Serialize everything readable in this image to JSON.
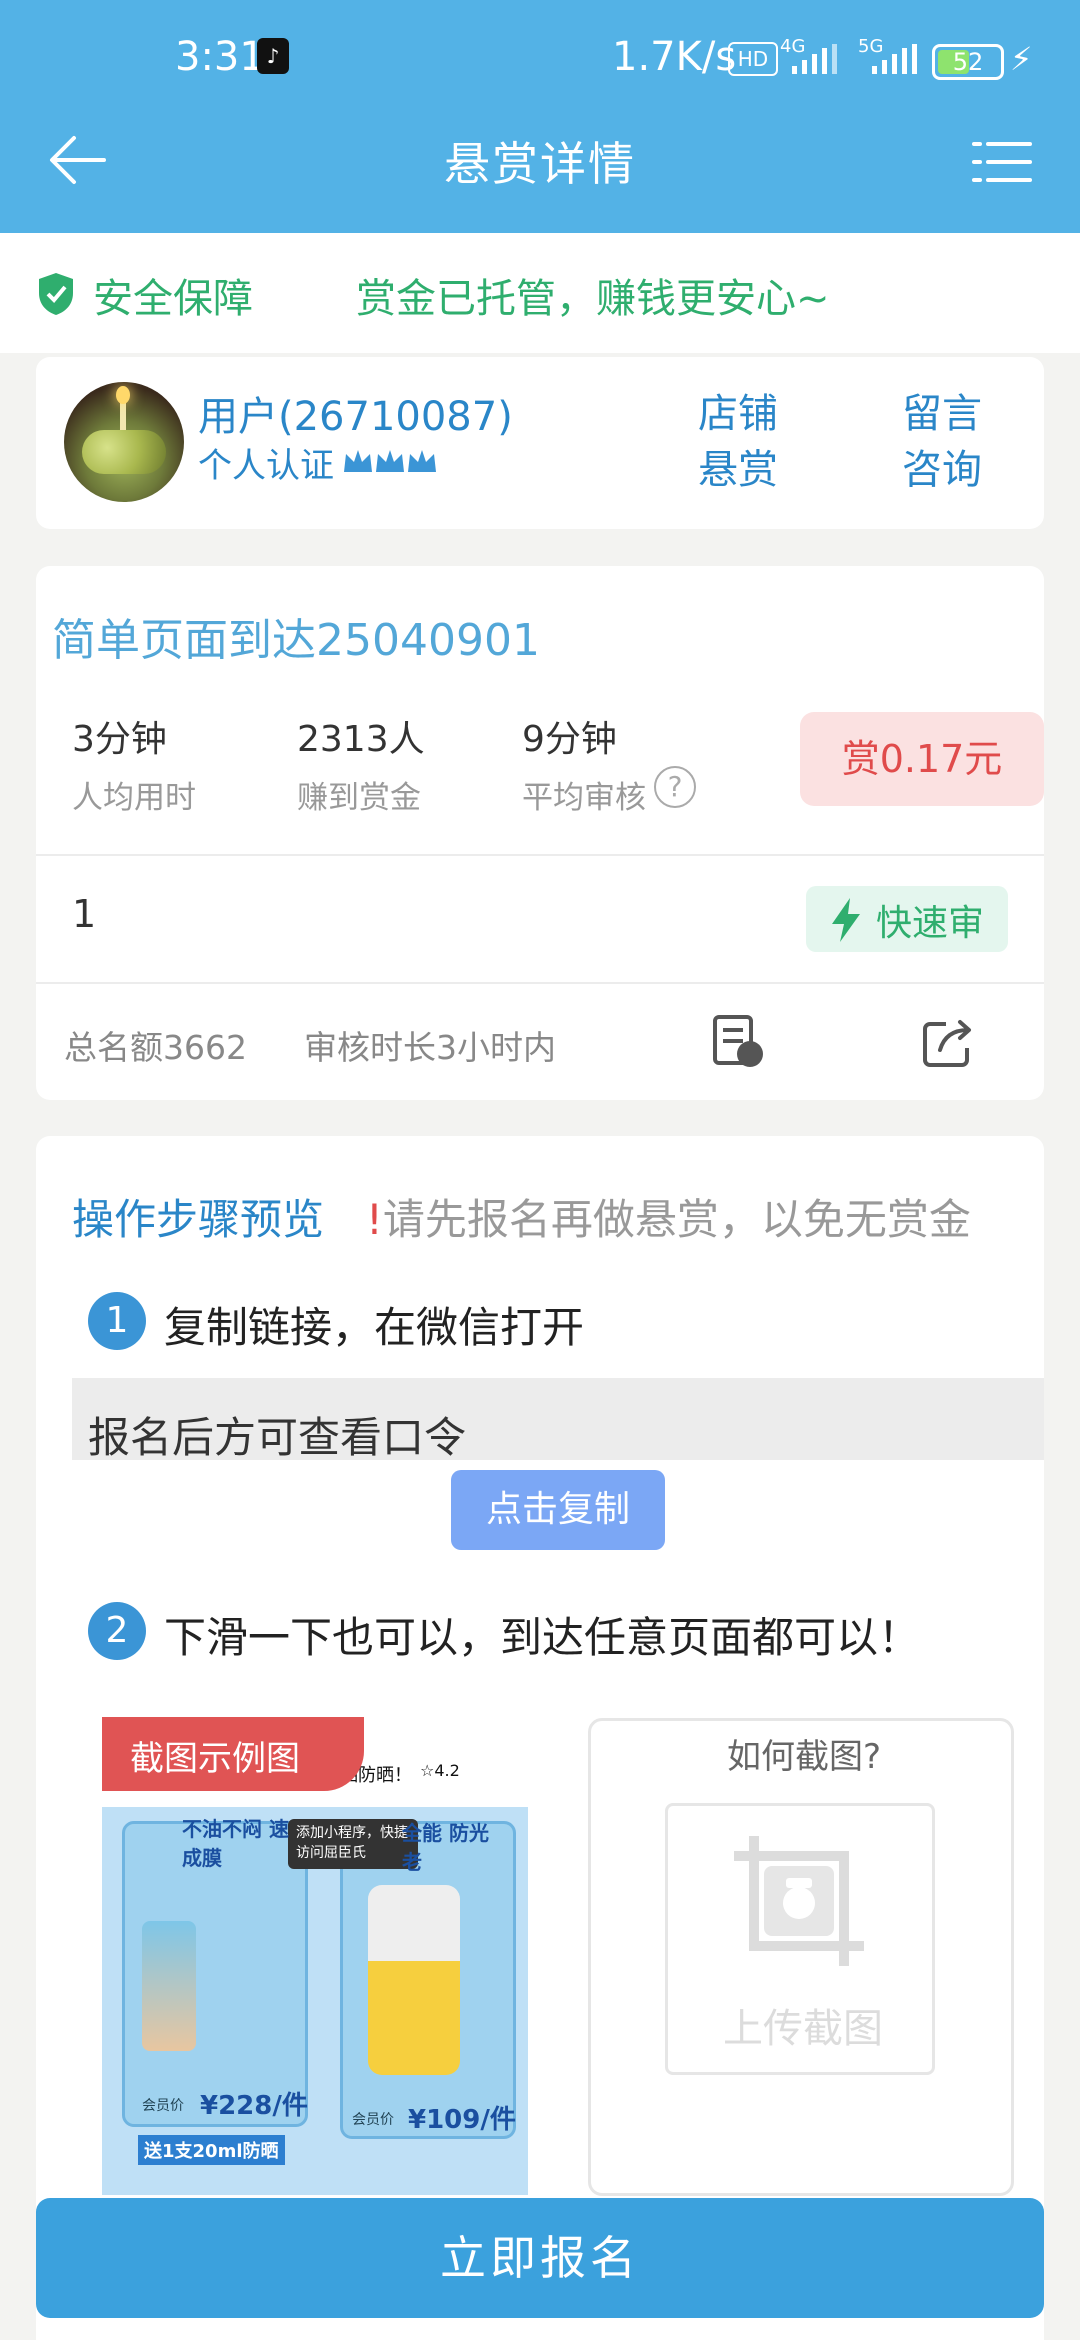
{
  "status_bar": {
    "time": "3:31",
    "net_speed": "1.7K/s",
    "hd_badge": "HD",
    "net1": "4G",
    "net2": "5G",
    "battery": "52",
    "battery_level": 0.52
  },
  "header": {
    "title": "悬赏详情"
  },
  "safety": {
    "label": "安全保障",
    "text": "赏金已托管，赚钱更安心~"
  },
  "publisher": {
    "name": "用户(26710087)",
    "cert": "个人认证",
    "store_btn": [
      "店铺",
      "悬赏"
    ],
    "message_btn": [
      "留言",
      "咨询"
    ]
  },
  "task": {
    "title": "简单页面到达25040901",
    "stats": [
      {
        "value": "3分钟",
        "label": "人均用时"
      },
      {
        "value": "2313人",
        "label": "赚到赏金"
      },
      {
        "value": "9分钟",
        "label": "平均审核"
      }
    ],
    "help": "?",
    "reward": "赏0.17元",
    "quantity": "1",
    "fast_review": "快速审",
    "total": "总名额3662",
    "review_time": "审核时长3小时内"
  },
  "steps": {
    "title": "操作步骤预览",
    "warn_bang": "!",
    "warning": "请先报名再做悬赏，以免无赏金",
    "step1_num": "1",
    "step1": "复制链接，在微信打开",
    "password_hint": "报名后方可查看口令",
    "copy_btn": "点击复制",
    "step2_num": "2",
    "step2": "下滑一下也可以，到达任意页面都可以！",
    "example_tag": "截图示例图",
    "example_texts": {
      "mini_title": "晒防晒！",
      "rating": "☆4.2",
      "tip": "添加小程序，快捷访问屈臣氏",
      "left_badge": "不油不闷 速成膜",
      "right_badge": "全能 防光老",
      "price_left": "¥228/件",
      "price_right": "¥109/件",
      "promo": "送1支20ml防晒",
      "member": "会员价"
    },
    "how_to": "如何截图?",
    "upload": "上传截图"
  },
  "cta": {
    "label": "立即报名"
  },
  "colors": {
    "header": "#53b2e6",
    "accent_blue": "#2a86c8",
    "green": "#2fae6e",
    "reward_bg": "#fbe1e1",
    "reward_text": "#e04b4b",
    "copy_btn": "#7ba7f5",
    "cta": "#3ba1dd"
  }
}
